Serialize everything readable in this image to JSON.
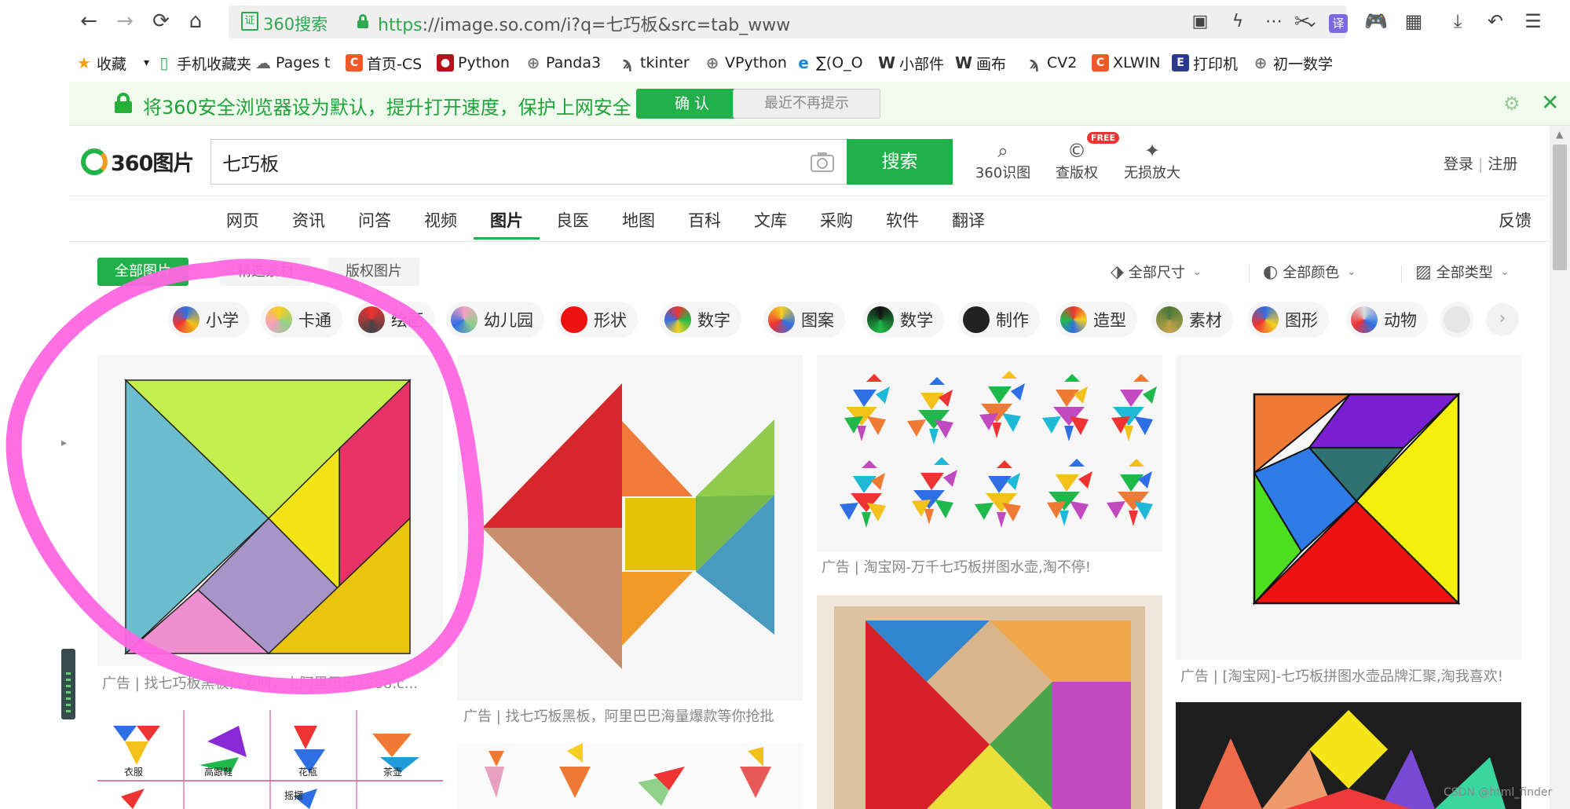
{
  "browser": {
    "nav": {
      "back": "←",
      "forward": "→",
      "reload": "⟳",
      "home": "⌂"
    },
    "address": {
      "brand": "360搜索",
      "protocol": "https",
      "rest": "://image.so.com/i?q=七巧板&src=tab_www"
    },
    "bookmarks": [
      {
        "label": "收藏",
        "icon": "star-icon"
      },
      {
        "label": "手机收藏夹",
        "icon": "phone-icon"
      },
      {
        "label": "Pages t",
        "icon": "cloud-icon"
      },
      {
        "label": "首页-CS",
        "icon": "csdn-icon"
      },
      {
        "label": "Python",
        "icon": "python-icon"
      },
      {
        "label": "Panda3",
        "icon": "globe-icon"
      },
      {
        "label": "tkinter",
        "icon": "snake-icon"
      },
      {
        "label": "VPython",
        "icon": "globe-icon"
      },
      {
        "label": "∑(O_O",
        "icon": "edge-icon"
      },
      {
        "label": "小部件",
        "icon": "w-icon"
      },
      {
        "label": "画布",
        "icon": "w-icon"
      },
      {
        "label": "CV2",
        "icon": "snake-icon"
      },
      {
        "label": "XLWIN",
        "icon": "csdn-icon"
      },
      {
        "label": "打印机",
        "icon": "e-icon"
      },
      {
        "label": "初一数学",
        "icon": "globe-icon"
      }
    ]
  },
  "notice": {
    "text": "将360安全浏览器设为默认，提升打开速度，保护上网安全",
    "confirm": "确 认",
    "dismiss": "最近不再提示"
  },
  "header": {
    "logo": "360图片",
    "search_value": "七巧板",
    "search_button": "搜索",
    "tools": [
      {
        "label": "360识图",
        "icon": "scan-icon"
      },
      {
        "label": "查版权",
        "icon": "copyright-icon"
      },
      {
        "label": "无损放大",
        "icon": "magic-icon"
      }
    ],
    "free_badge": "FREE",
    "login": "登录",
    "register": "注册"
  },
  "category_tabs": [
    "网页",
    "资讯",
    "问答",
    "视频",
    "图片",
    "良医",
    "地图",
    "百科",
    "文库",
    "采购",
    "软件",
    "翻译"
  ],
  "active_tab": "图片",
  "feedback": "反馈",
  "filters": {
    "buttons": [
      "全部图片",
      "精选素材",
      "版权图片"
    ],
    "active": "全部图片",
    "dropdowns": [
      "全部尺寸",
      "全部颜色",
      "全部类型"
    ]
  },
  "tags": [
    "小学",
    "卡通",
    "绘画",
    "幼儿园",
    "形状",
    "数字",
    "图案",
    "数学",
    "制作",
    "造型",
    "素材",
    "图形",
    "动物"
  ],
  "results": {
    "captions": [
      "广告 | 找七巧板黑板批发网，上阿里巴巴1688.c...",
      "广告 | 找七巧板黑板，阿里巴巴海量爆款等你抢批",
      "广告 | 淘宝网-万千七巧板拼图水壶,淘不停!",
      "广告 | [淘宝网]-七巧板拼图水壶品牌汇聚,淘我喜欢!"
    ],
    "card5_labels": [
      "衣服",
      "高跟鞋",
      "花瓶",
      "茶壶",
      "摇摆"
    ]
  },
  "watermark": "CSDN @html_finder",
  "colors": {
    "accent": "#22b04a",
    "annotation": "#ff66e0",
    "notice_bg": "#f0fbee"
  }
}
